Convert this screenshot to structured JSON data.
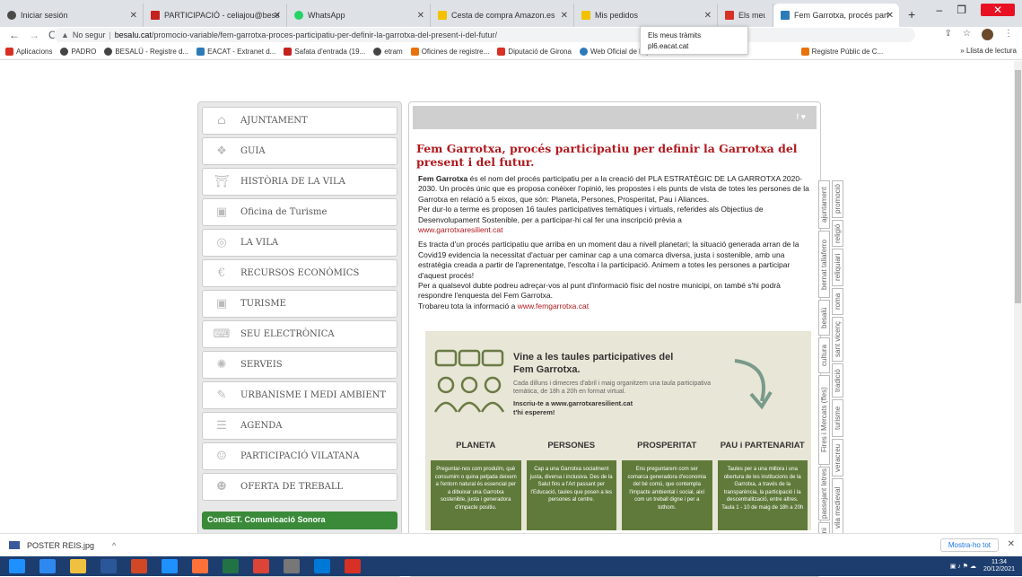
{
  "browser": {
    "tabs": [
      {
        "label": "Iniciar sesión",
        "color": "#4a4a4a"
      },
      {
        "label": "PARTICIPACIÓ - celiajou@besalu.c",
        "color": "#c5221f"
      },
      {
        "label": "WhatsApp",
        "color": "#25d366"
      },
      {
        "label": "Cesta de compra Amazon.es",
        "color": "#f2c200"
      },
      {
        "label": "Mis pedidos",
        "color": "#f2c200"
      },
      {
        "label": "Els meus tràmits",
        "color": "#d93025"
      },
      {
        "label": "Fem Garrotxa, procés participatiu",
        "color": "#2b7bb9"
      }
    ],
    "new_tab": "+",
    "url_warning": "No segur",
    "url_domain": "besalu.cat",
    "url_path": "/promocio-variable/fem-garrotxa-proces-participatiu-per-definir-la-garrotxa-del-present-i-del-futur/",
    "tooltip_title": "Els meus tràmits",
    "tooltip_url": "pl6.eacat.cat",
    "bookmarks": [
      {
        "label": "Aplicacions",
        "color": "#d93025"
      },
      {
        "label": "PADRO",
        "color": "#444"
      },
      {
        "label": "BESALÚ - Registre d...",
        "color": "#444"
      },
      {
        "label": "EACAT - Extranet d...",
        "color": "#2b7bb9"
      },
      {
        "label": "Safata d'entrada (19...",
        "color": "#c5221f"
      },
      {
        "label": "etram",
        "color": "#444"
      },
      {
        "label": "Oficines de registre...",
        "color": "#e8710a"
      },
      {
        "label": "Diputació de Girona",
        "color": "#d93025"
      },
      {
        "label": "Web Oficial de l'Aju...",
        "color": "#2b7bb9"
      },
      {
        "label": "Registre Públic de C...",
        "color": "#e8710a"
      }
    ],
    "bookmarks_more": "»  Llista de lectura"
  },
  "menu": {
    "items": [
      {
        "label": "AJUNTAMENT",
        "icon": "⌂"
      },
      {
        "label": "GUIA",
        "icon": "❖"
      },
      {
        "label": "HISTÒRIA DE LA VILA",
        "icon": "⛩"
      },
      {
        "label": "Oficina de Turisme",
        "icon": "▣"
      },
      {
        "label": "LA VILA",
        "icon": "◎"
      },
      {
        "label": "RECURSOS ECONÒMICS",
        "icon": "€"
      },
      {
        "label": "TURISME",
        "icon": "▣"
      },
      {
        "label": "SEU ELECTRÒNICA",
        "icon": "⌨"
      },
      {
        "label": "SERVEIS",
        "icon": "✺"
      },
      {
        "label": "URBANISME I MEDI AMBIENT",
        "icon": "✎"
      },
      {
        "label": "AGENDA",
        "icon": "☰"
      },
      {
        "label": "PARTICIPACIÓ VILATANA",
        "icon": "☺"
      },
      {
        "label": "OFERTA DE TREBALL",
        "icon": "☻"
      }
    ],
    "banner": "ComSET. Comunicació Sonora"
  },
  "article": {
    "social": "f  ♥",
    "title": "Fem Garrotxa, procés participatiu per definir la Garrotxa del present i del futur.",
    "p1_bold": "Fem Garrotxa",
    "p1": " és el nom del procés participatiu per a la creació del PLA ESTRATÈGIC DE LA GARROTXA 2020-2030. Un procés únic que es proposa conèixer l'opinió, les propostes i els punts de vista de totes les persones de la Garrotxa en relació a 5 eixos, que són: Planeta, Persones, Prosperitat, Pau i Aliances.",
    "p2": "Per dur-lo a terme es proposen 16 taules participatives temàtiques i virtuals, referides als Objectius de Desenvolupament Sostenible, per a participar-hi cal fer una inscripció prèvia a",
    "link1": "www.garrotxaresilient.cat",
    "p3": "Es tracta d'un procés participatiu que arriba en un moment dau a nivell planetari; la situació generada arran de la Covid19 evidencia la necessitat d'actuar per caminar cap a una comarca diversa, justa i sostenible, amb una estratègia creada a partir de l'aprenentatge, l'escolta i la participació. Animem a totes les persones a participar d'aquest procés!",
    "p4": "Per a qualsevol dubte podreu adreçar-vos al punt d'informació físic del nostre municipi, on també s'hi podrà respondre l'enquesta del Fem Garrotxa.",
    "p5": "Trobareu tota la informació a",
    "link2": "www.femgarrotxa.cat"
  },
  "poster": {
    "head1": "Vine a les taules participatives del",
    "head2": "Fem Garrotxa.",
    "sub": "Cada dilluns i dimecres d'abril i maig organitzem una taula participativa temàtica, de 18h a 20h en format virtual.",
    "cta1": "Inscriu-te a www.garrotxaresilient.cat",
    "cta2": "t'hi esperem!",
    "cols": [
      {
        "head": "PLANETA",
        "text": "Preguntar-nos com produïm, què consumim o quina petjada deixem a l'entorn natural és essencial per a dibuixar una Garrotxa sostenible, justa i generadora d'impacte positiu."
      },
      {
        "head": "PERSONES",
        "text": "Cap a una Garrotxa socialment justa, diversa i inclusiva. Des de la Salut fins a l'Art passant per l'Educació, taules que posen a les persones al centre."
      },
      {
        "head": "PROSPERITAT",
        "text": "Ens preguntarem com ser comarca generadora d'economia del bé comú, que contempla l'impacte ambiental i social, així com un treball digne i per a tothom."
      },
      {
        "head": "PAU i PARTENARIAT",
        "text": "Taules per a una millora i una obertura de les institucions de la Garrotxa, a través de la transparència, la participació i la descentralització, entre altres. Taula 1 - 10 de maig de 18h a 20h"
      }
    ]
  },
  "sidetabs": {
    "left": [
      "ajuntament",
      "bernat tallaferro",
      "besalú",
      "cultura",
      "Fires i Mercats (ffes)",
      "passejant letres",
      "patrimoni"
    ],
    "right": [
      "promoció",
      "religió",
      "reliquiari",
      "roma",
      "sant vicenç",
      "tradició",
      "turisme",
      "veracreu",
      "vila medieval"
    ]
  },
  "downloads": {
    "file": "POSTER REIS.jpg",
    "chevron": "^",
    "show_all": "Mostra-ho tot",
    "close": "✕"
  },
  "taskbar": {
    "icons": [
      "#1e90ff",
      "#2d89ef",
      "#f0c040",
      "#2b579a",
      "#d24726",
      "#1e90ff",
      "#ff7139",
      "#217346",
      "#db4437",
      "#777",
      "#0078d7",
      "#d93025"
    ],
    "time": "11:34",
    "date": "20/12/2021"
  }
}
